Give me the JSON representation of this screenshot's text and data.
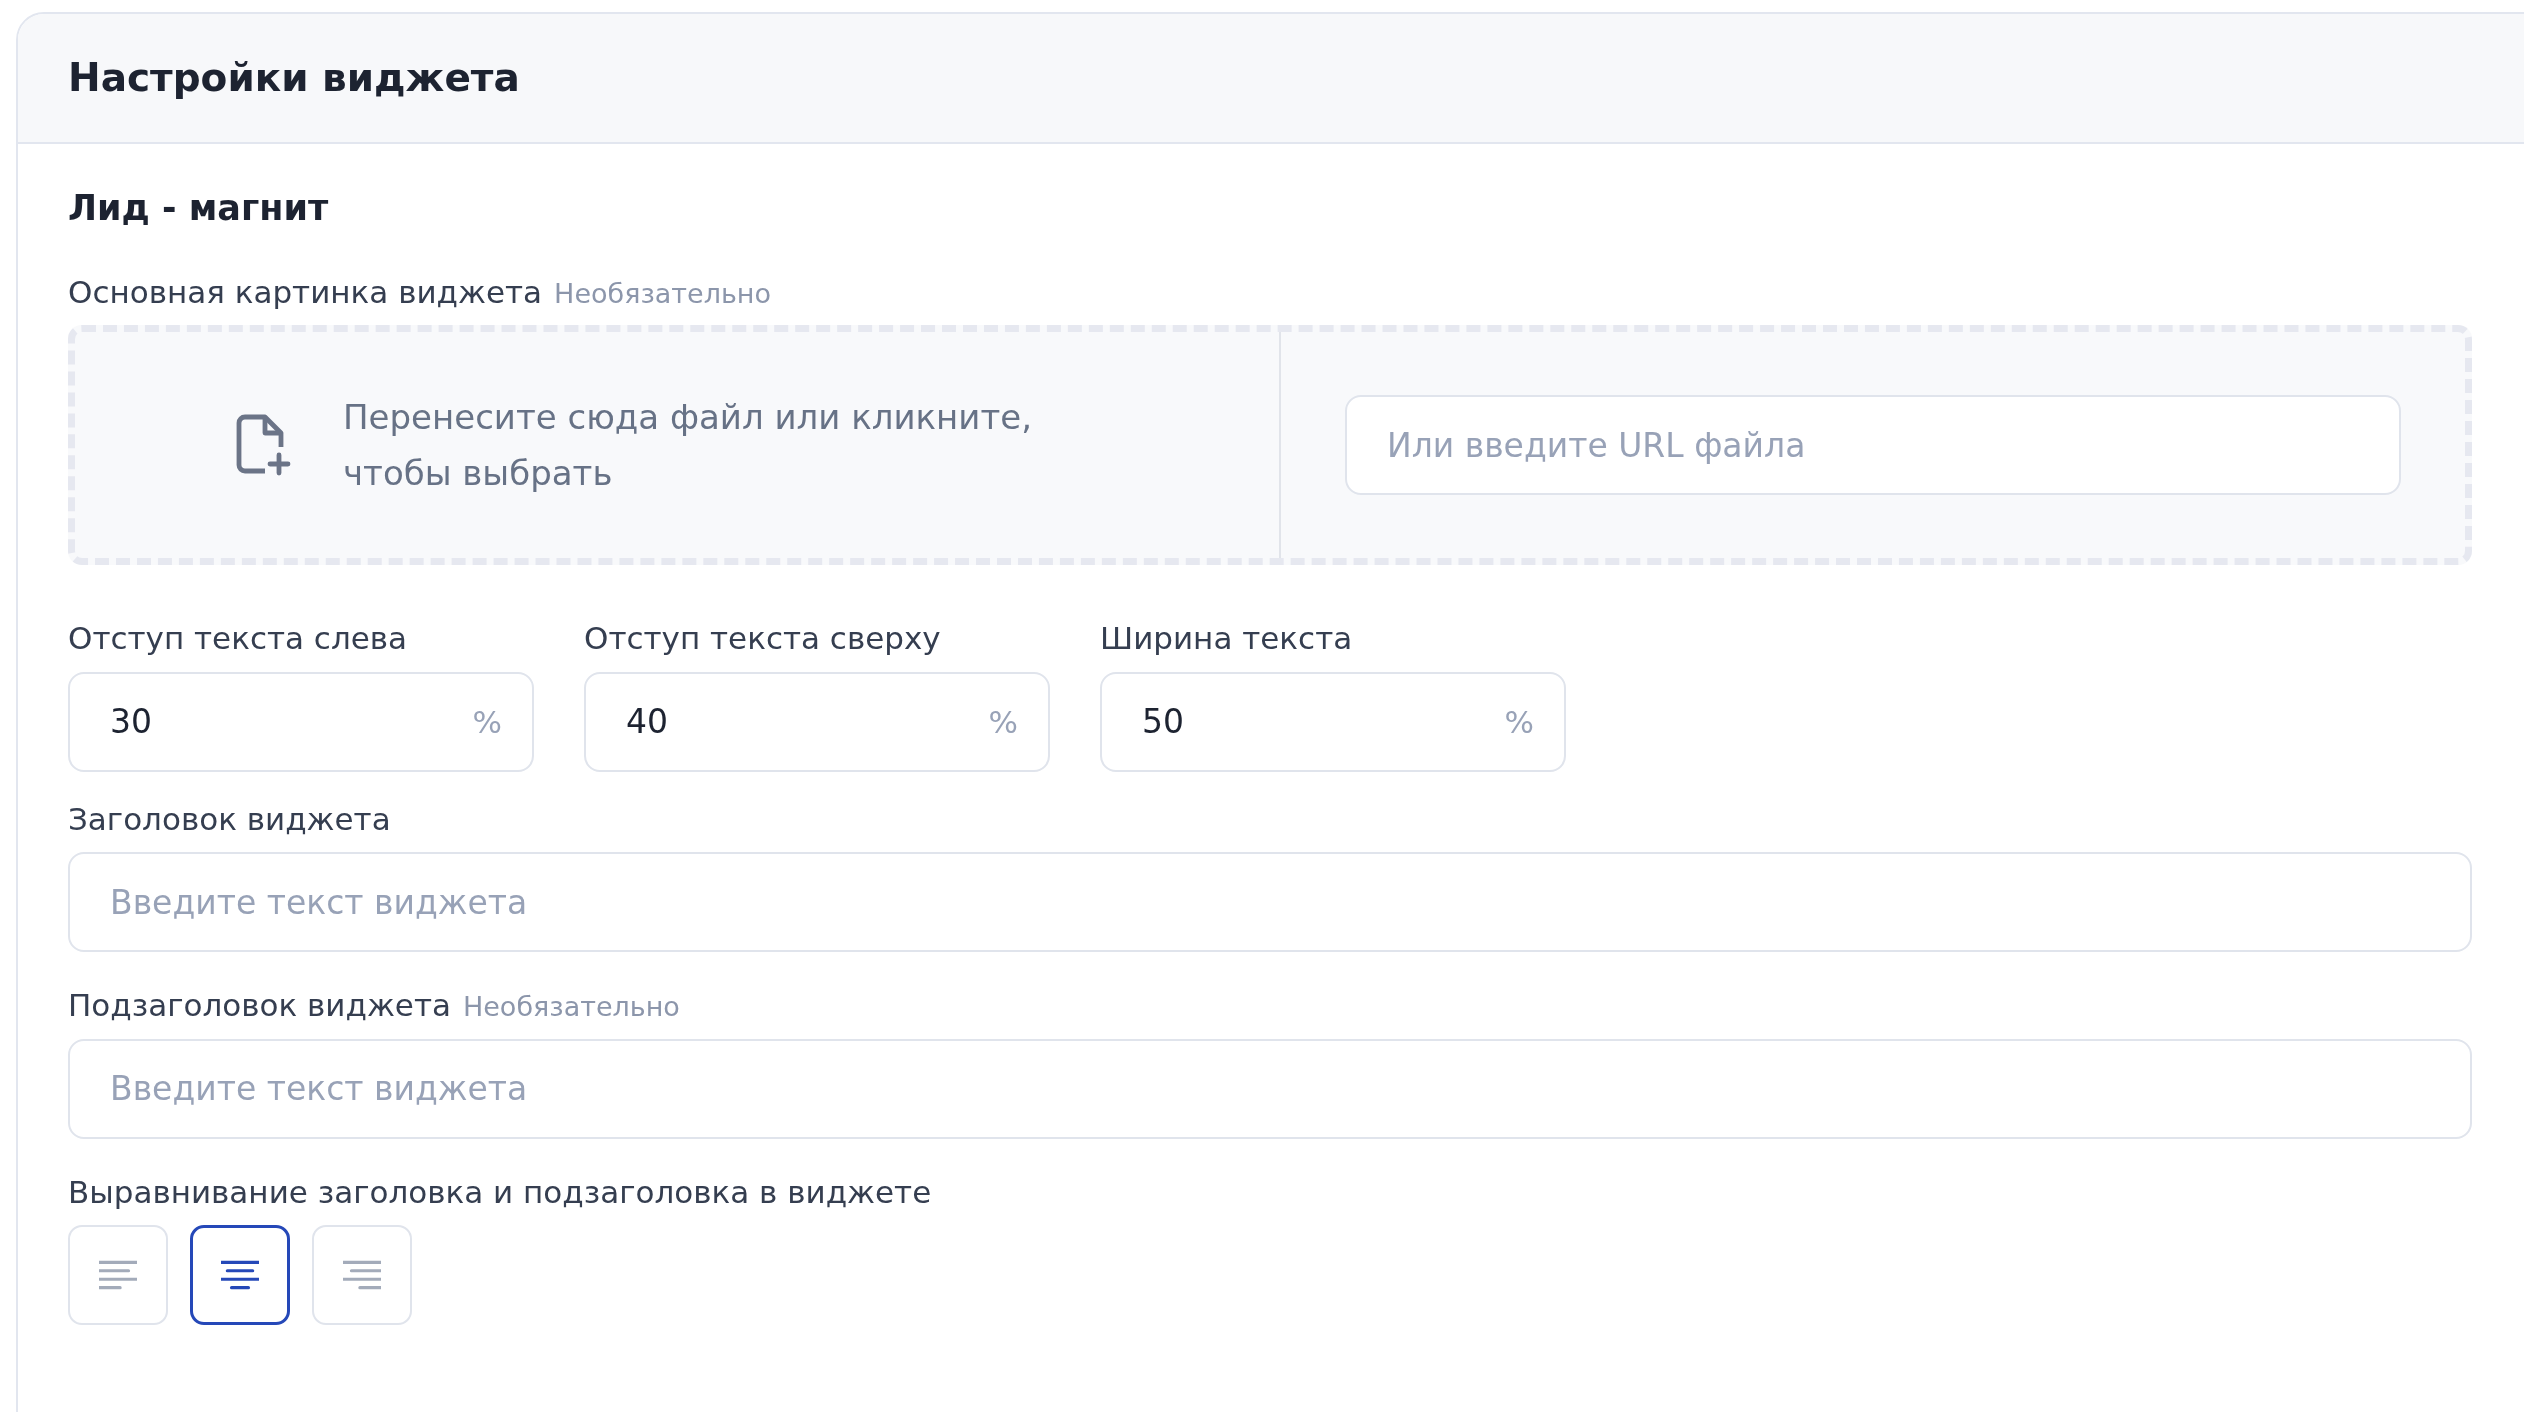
{
  "panel": {
    "title": "Настройки виджета"
  },
  "section_title": "Лид - магнит",
  "image_field": {
    "label": "Основная картинка виджета",
    "hint": "Необязательно",
    "drop_text": "Перенесите сюда файл или кликните, чтобы выбрать",
    "url_placeholder": "Или введите URL файла"
  },
  "number_fields": [
    {
      "label": "Отступ текста слева",
      "value": "30",
      "unit": "%"
    },
    {
      "label": "Отступ текста сверху",
      "value": "40",
      "unit": "%"
    },
    {
      "label": "Ширина текста",
      "value": "50",
      "unit": "%"
    }
  ],
  "text_fields": [
    {
      "label": "Заголовок виджета",
      "placeholder": "Введите текст виджета"
    },
    {
      "label": "Подзаголовок виджета",
      "hint": "Необязательно",
      "placeholder": "Введите текст виджета"
    }
  ],
  "alignment": {
    "label": "Выравнивание заголовка и подзаголовка в виджете",
    "options": [
      {
        "kind": "left",
        "selected": false
      },
      {
        "kind": "center",
        "selected": true
      },
      {
        "kind": "right",
        "selected": false
      }
    ]
  }
}
